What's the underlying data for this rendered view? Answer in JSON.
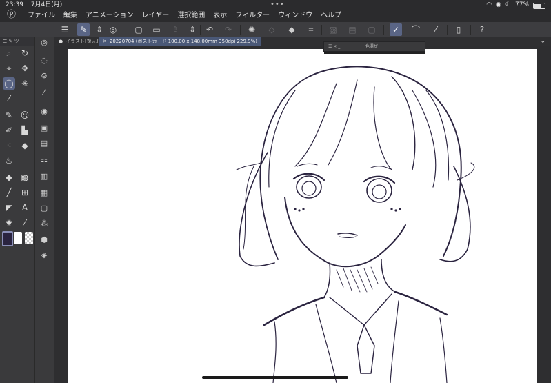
{
  "status": {
    "time": "23:39",
    "date": "7月4日(月)",
    "battery": "77%"
  },
  "menu": {
    "items": [
      "ファイル",
      "編集",
      "アニメーション",
      "レイヤー",
      "選択範囲",
      "表示",
      "フィルター",
      "ウィンドウ",
      "ヘルプ"
    ]
  },
  "tabs": {
    "tab1": "イラスト[復元]*",
    "tab2": "20220704 (ポストカード 100.00 x 148.00mm 350dpi 229.9%)"
  },
  "left_panel": {
    "header": "ツ"
  },
  "float_palette": {
    "title": "色混ぜ"
  },
  "colors": {
    "main_color": "#2a2440",
    "sub_color": "#ffffff",
    "accent": "#5a6585"
  }
}
